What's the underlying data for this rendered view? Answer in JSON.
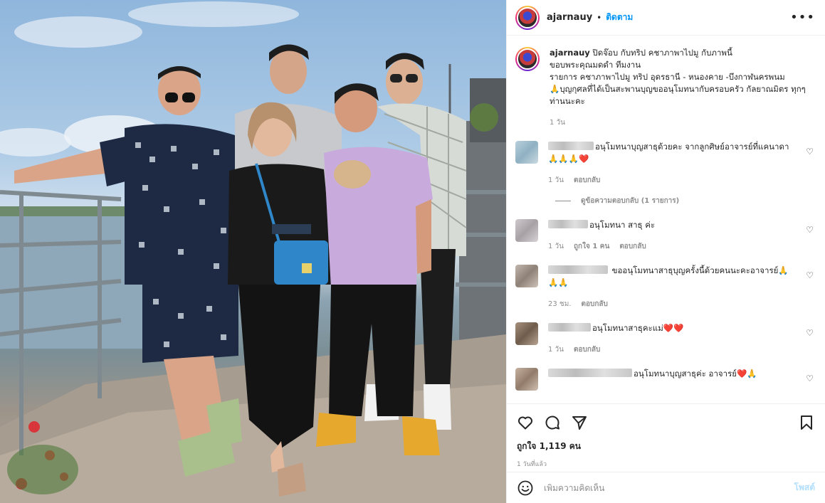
{
  "post": {
    "username": "ajarnauy",
    "separator": "•",
    "follow_label": "ติดตาม",
    "more_label": "•••"
  },
  "caption": {
    "username": "ajarnauy",
    "line1": "ปิดจ๊อบ กับทริป คชาภาพาไปมู กับภาพนี้",
    "line2": "ขอบพระคุณมดดำ ทีมงาน",
    "line3": "รายการ คชาภาพาไปมู ทริป อุดรธานี - หนองคาย -บึงกาฬนครพนม",
    "line4": "🙏บุญกุศลที่ได้เป็นสะพานบุญขออนุโมทนากับครอบครัว กัลยาณมิตร ทุกๆ ท่านนะคะ",
    "time": "1 วัน"
  },
  "comments": [
    {
      "text": "อนุโมทนาบุญสาธุด้วยคะ จากลูกศิษย์อาจารย์ที่แคนาดา 🙏🙏🙏❤️",
      "time": "1 วัน",
      "likes": "",
      "reply": "ตอบกลับ",
      "avatar_color": "#9ab8c6"
    },
    {
      "text": "อนุโมทนา สาธุ ค่ะ",
      "time": "1 วัน",
      "likes": "ถูกใจ 1 คน",
      "reply": "ตอบกลับ",
      "avatar_color": "#b9b3b8"
    },
    {
      "text": "ขออนุโมทนาสาธุบุญครั้งนี้ด้วยคนนะคะอาจารย์🙏🙏🙏",
      "time": "23 ชม.",
      "likes": "",
      "reply": "ตอบกลับ",
      "avatar_color": "#a49a92"
    },
    {
      "text": "อนุโมทนาสาธุคะแม่❤️❤️",
      "time": "1 วัน",
      "likes": "",
      "reply": "ตอบกลับ",
      "avatar_color": "#8d7b6a"
    },
    {
      "text": "อนุโมทนาบุญสาธุค่ะ อาจารย์❤️🙏",
      "time": "",
      "likes": "",
      "reply": "",
      "avatar_color": "#a89383"
    }
  ],
  "view_replies": "ดูข้อความตอบกลับ (1 รายการ)",
  "actions": {
    "icons": [
      "heart-icon",
      "comment-icon",
      "share-icon",
      "bookmark-icon"
    ],
    "likes": "ถูกใจ 1,119 คน",
    "posted": "1 วันที่แล้ว"
  },
  "add_comment": {
    "placeholder": "เพิ่มความคิดเห็น",
    "post_label": "โพสต์"
  },
  "colors": {
    "link": "#0095f6",
    "post_disabled": "#b2dffc",
    "muted": "#8e8e8e",
    "heart": "#ed4956"
  }
}
